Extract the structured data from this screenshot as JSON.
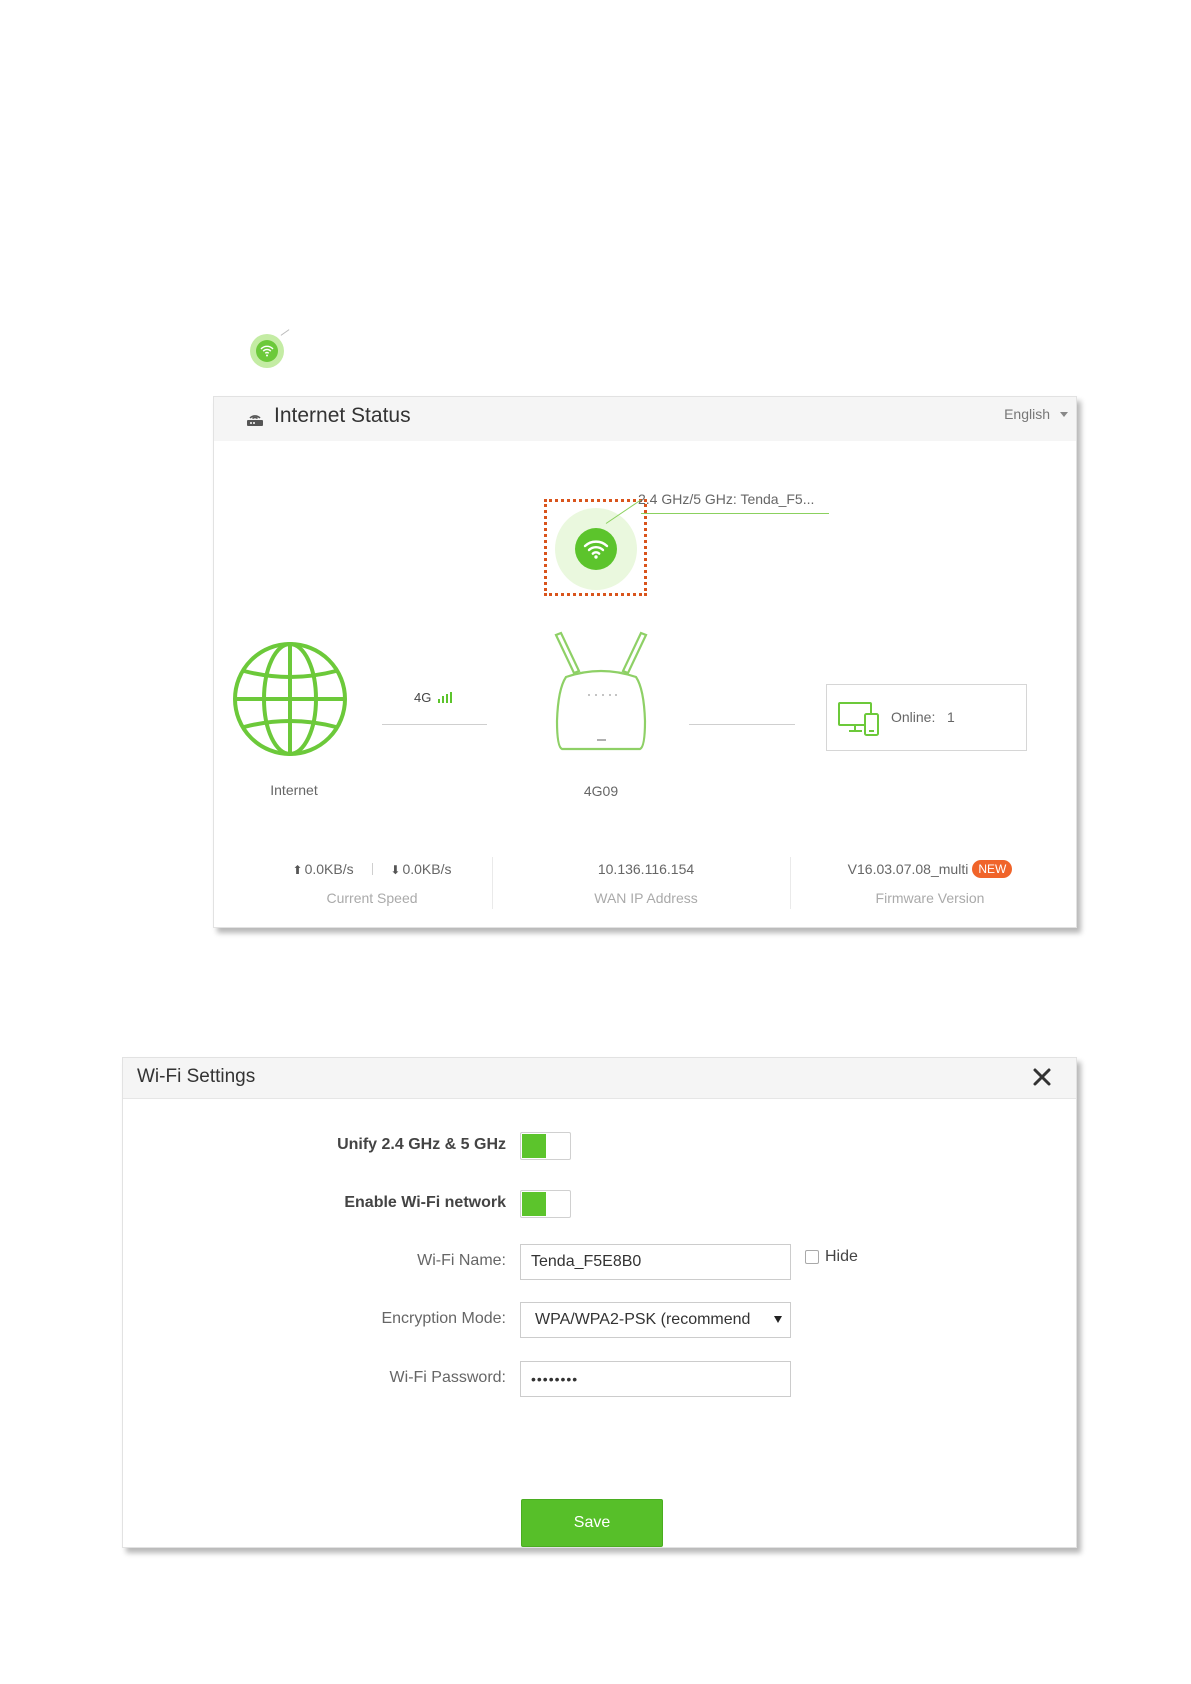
{
  "status_panel": {
    "title": "Internet Status",
    "language": "English",
    "ssid_text": "2.4 GHz/5 GHz: Tenda_F5...",
    "internet_label": "Internet",
    "network_type": "4G",
    "router_label": "4G09",
    "online_label": "Online:",
    "online_count": "1",
    "upload_speed": "0.0KB/s",
    "download_speed": "0.0KB/s",
    "speed_caption": "Current Speed",
    "wan_ip": "10.136.116.154",
    "wan_caption": "WAN IP Address",
    "firmware": "V16.03.07.08_multi",
    "new_badge": "NEW",
    "firmware_caption": "Firmware Version"
  },
  "wifi_settings": {
    "title": "Wi-Fi Settings",
    "unify_label": "Unify 2.4 GHz & 5 GHz",
    "unify_on": true,
    "enable_label": "Enable Wi-Fi network",
    "enable_on": true,
    "name_label": "Wi-Fi Name:",
    "name_value": "Tenda_F5E8B0",
    "hide_label": "Hide",
    "hide_checked": false,
    "encryption_label": "Encryption Mode:",
    "encryption_value": "WPA/WPA2-PSK (recommend",
    "password_label": "Wi-Fi Password:",
    "password_value": "••••••••",
    "save_label": "Save"
  },
  "colors": {
    "accent_green": "#5cc42c",
    "highlight_orange": "#d9541c",
    "badge_orange": "#f0642a"
  },
  "icons": [
    "wifi-icon",
    "router-status-icon",
    "globe-icon",
    "signal-bars-icon",
    "router-device-icon",
    "devices-icon",
    "upload-arrow-icon",
    "download-arrow-icon",
    "close-icon",
    "dropdown-caret-icon"
  ]
}
